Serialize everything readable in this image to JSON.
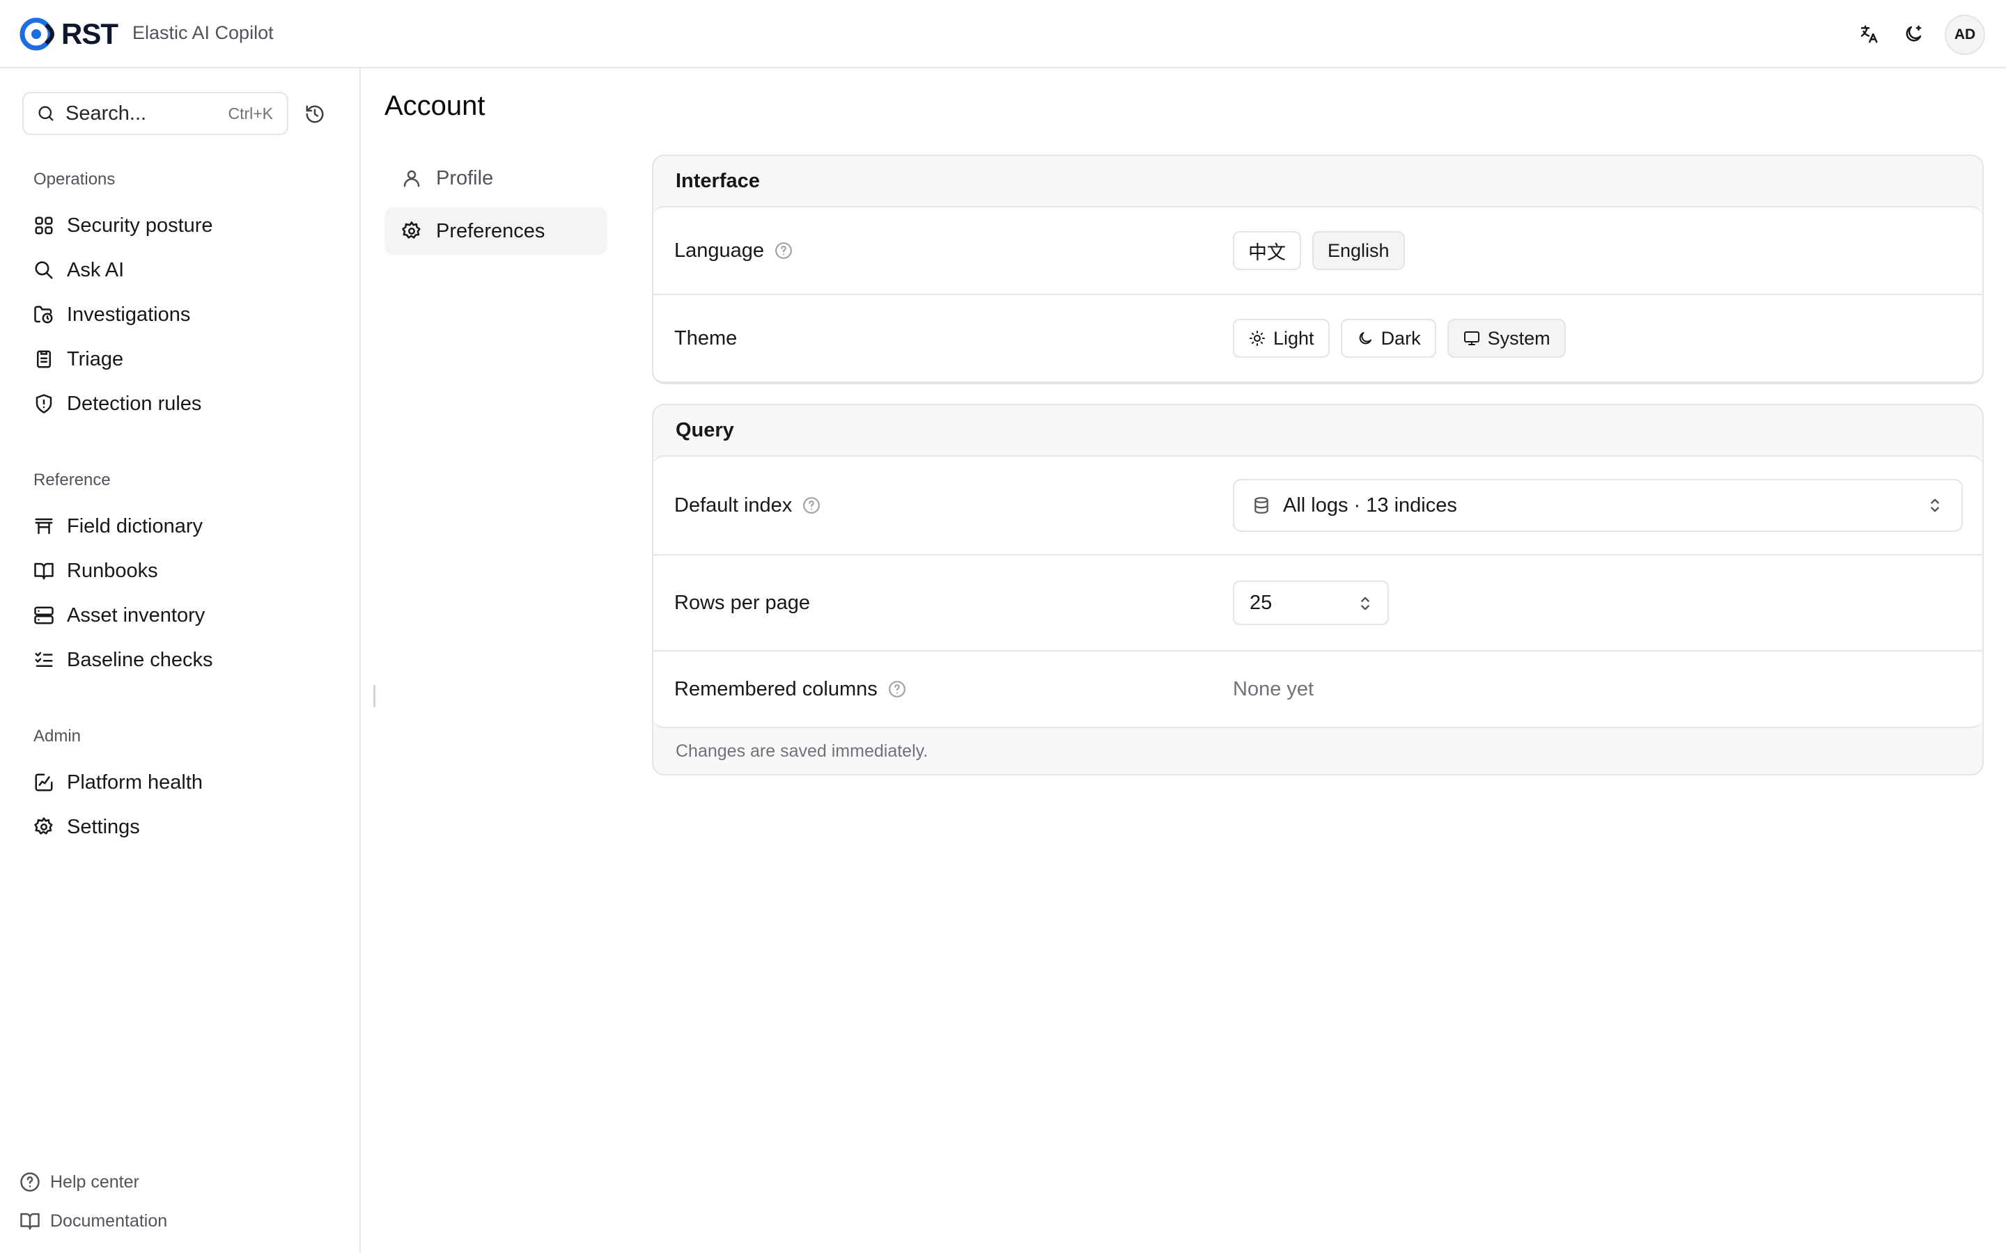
{
  "header": {
    "logo_text": "RST",
    "app_subtitle": "Elastic AI Copilot",
    "avatar_initials": "AD",
    "icons": [
      "translate-icon",
      "moon-star-icon"
    ]
  },
  "sidebar": {
    "search": {
      "placeholder": "Search...",
      "shortcut": "Ctrl+K"
    },
    "groups": [
      {
        "label": "Operations",
        "items": [
          {
            "label": "Security posture",
            "icon": "grid-icon"
          },
          {
            "label": "Ask AI",
            "icon": "search-icon"
          },
          {
            "label": "Investigations",
            "icon": "folder-clock-icon"
          },
          {
            "label": "Triage",
            "icon": "clipboard-list-icon"
          },
          {
            "label": "Detection rules",
            "icon": "shield-alert-icon"
          }
        ]
      },
      {
        "label": "Reference",
        "items": [
          {
            "label": "Field dictionary",
            "icon": "table-header-icon"
          },
          {
            "label": "Runbooks",
            "icon": "book-open-icon"
          },
          {
            "label": "Asset inventory",
            "icon": "server-icon"
          },
          {
            "label": "Baseline checks",
            "icon": "list-checks-icon"
          }
        ]
      },
      {
        "label": "Admin",
        "items": [
          {
            "label": "Platform health",
            "icon": "activity-square-icon"
          },
          {
            "label": "Settings",
            "icon": "gear-icon"
          }
        ]
      }
    ],
    "footer": [
      {
        "label": "Help center",
        "icon": "help-circle-icon"
      },
      {
        "label": "Documentation",
        "icon": "book-icon"
      }
    ]
  },
  "main": {
    "title": "Account",
    "subnav": [
      {
        "label": "Profile",
        "icon": "user-icon",
        "active": false
      },
      {
        "label": "Preferences",
        "icon": "gear-icon",
        "active": true
      }
    ],
    "interface": {
      "heading": "Interface",
      "language": {
        "label": "Language",
        "options": [
          "中文",
          "English"
        ],
        "selected": "English"
      },
      "theme": {
        "label": "Theme",
        "options": [
          "Light",
          "Dark",
          "System"
        ],
        "selected": "System"
      }
    },
    "query": {
      "heading": "Query",
      "default_index": {
        "label": "Default index",
        "value": "All logs · 13 indices"
      },
      "rows_per_page": {
        "label": "Rows per page",
        "value": "25"
      },
      "remembered_columns": {
        "label": "Remembered columns",
        "value": "None yet"
      },
      "note": "Changes are saved immediately."
    }
  },
  "colors": {
    "logo_blue": "#1d6fe0",
    "border": "#e4e4e7",
    "muted": "#71717a"
  }
}
